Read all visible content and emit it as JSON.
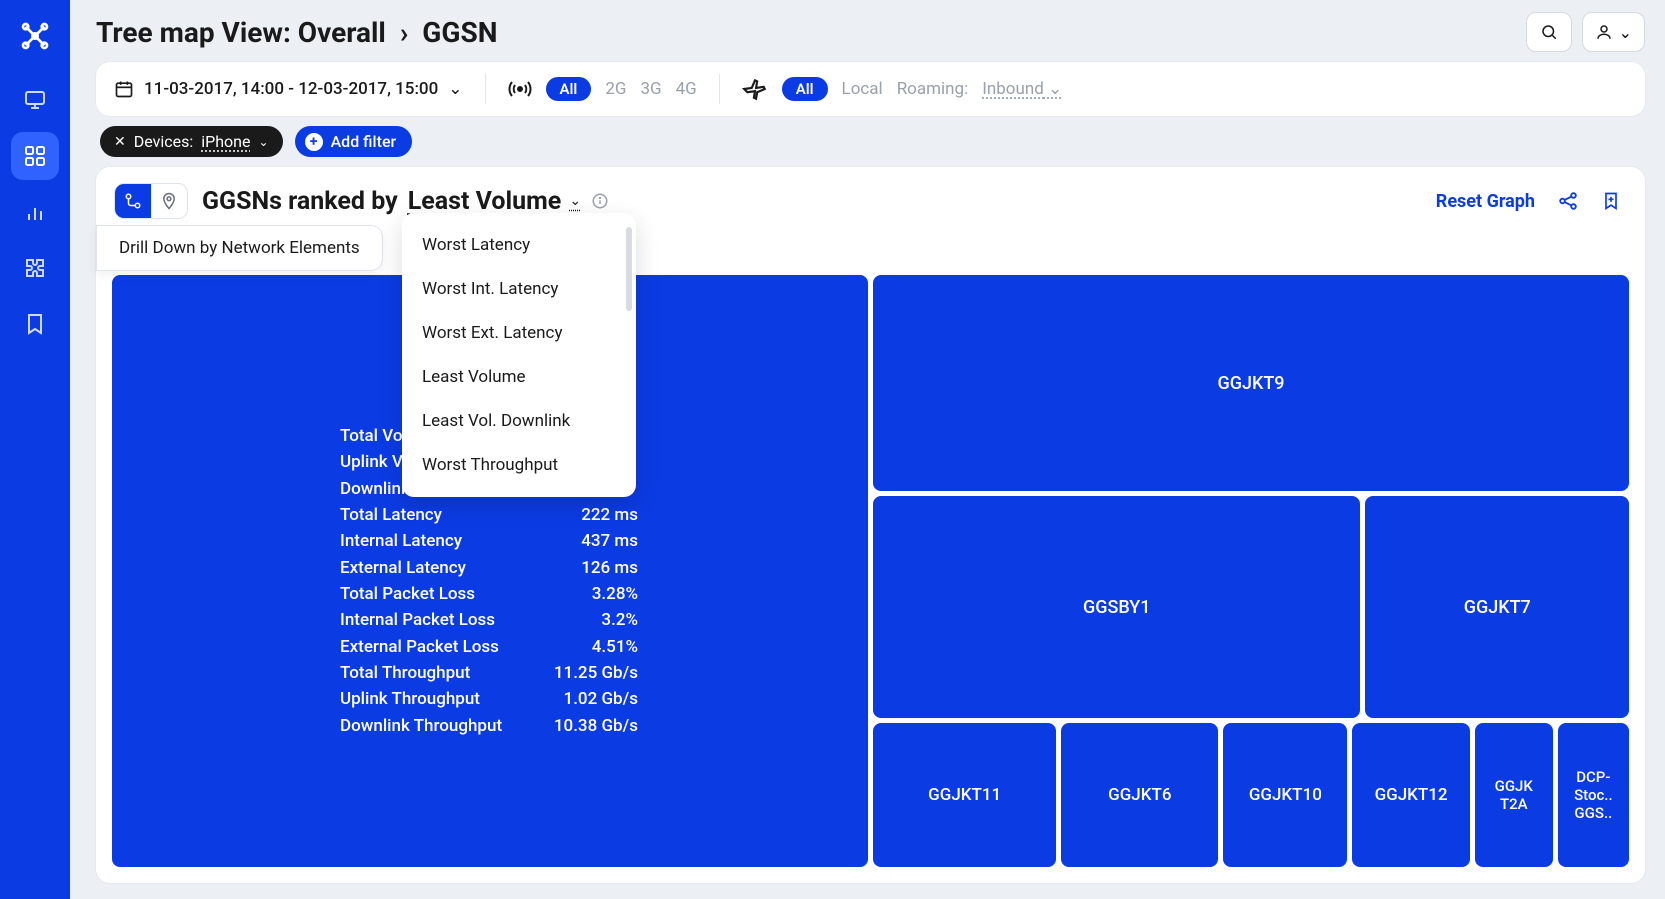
{
  "header": {
    "title_prefix": "Tree map View: Overall",
    "title_current": "GGSN"
  },
  "filters": {
    "date_range": "11-03-2017, 14:00 - 12-03-2017, 15:00",
    "network": {
      "all": "All",
      "g2": "2G",
      "g3": "3G",
      "g4": "4G"
    },
    "roaming": {
      "all": "All",
      "local": "Local",
      "roaming_label": "Roaming:",
      "roaming_value": "Inbound"
    },
    "device_chip": {
      "label": "Devices:",
      "value": "iPhone"
    },
    "add_filter": "Add filter"
  },
  "card": {
    "rank_prefix": "GGSNs ranked by",
    "rank_value": "Least Volume",
    "reset": "Reset Graph",
    "drill_label": "Drill Down by Network Elements",
    "dropdown": [
      "Worst Latency",
      "Worst Int. Latency",
      "Worst Ext. Latency",
      "Least Volume",
      "Least Vol. Downlink",
      "Worst Throughput"
    ]
  },
  "treemap": {
    "main_stats": [
      {
        "label": "Total Volu",
        "value": ""
      },
      {
        "label": "Uplink Vol",
        "value": ""
      },
      {
        "label": "Downlink",
        "value": ""
      },
      {
        "label": "Total Latency",
        "value": "222 ms"
      },
      {
        "label": "Internal Latency",
        "value": "437 ms"
      },
      {
        "label": "External Latency",
        "value": "126 ms"
      },
      {
        "label": "Total Packet Loss",
        "value": "3.28%"
      },
      {
        "label": "Internal Packet Loss",
        "value": "3.2%"
      },
      {
        "label": "External Packet Loss",
        "value": "4.51%"
      },
      {
        "label": "Total Throughput",
        "value": "11.25 Gb/s"
      },
      {
        "label": "Uplink Throughput",
        "value": "1.02 Gb/s"
      },
      {
        "label": "Downlink Throughput",
        "value": "10.38 Gb/s"
      }
    ],
    "tiles": {
      "r1": "GGJKT9",
      "r2a": "GGSBY1",
      "r2b": "GGJKT7",
      "r3": [
        "GGJKT11",
        "GGJKT6",
        "GGJKT10",
        "GGJKT12",
        "GGJK T2A",
        "DCP-Stoc.. GGS.."
      ]
    }
  }
}
